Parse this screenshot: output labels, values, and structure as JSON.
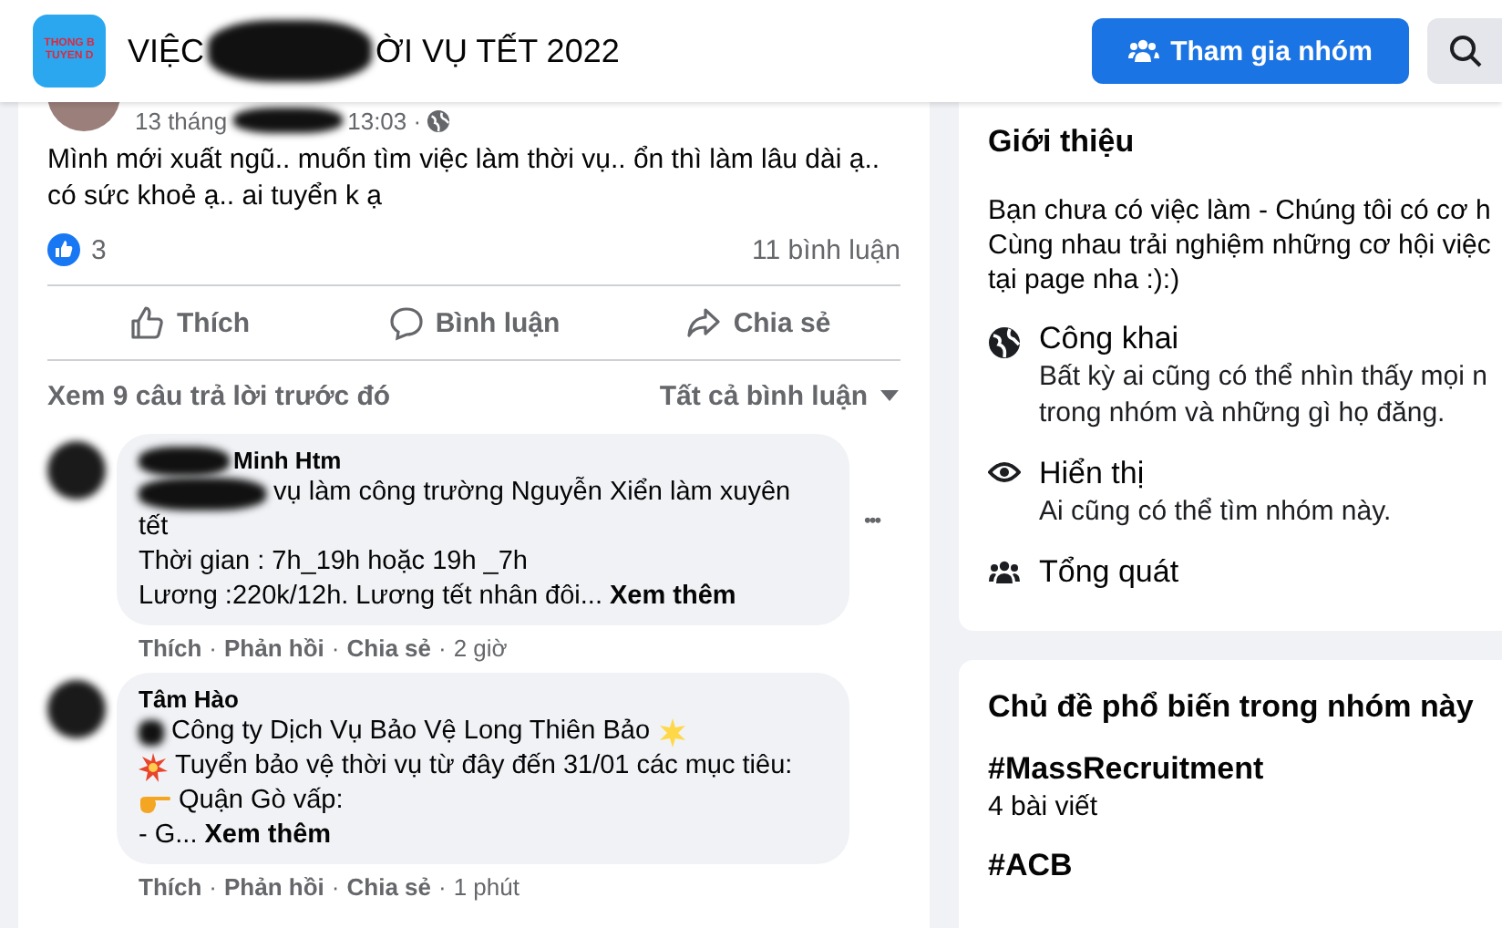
{
  "header": {
    "logo_lines": [
      "THONG B",
      "TUYEN D"
    ],
    "title_parts": [
      {
        "kind": "text",
        "text": "VIỆC"
      },
      {
        "kind": "redaction"
      },
      {
        "kind": "text",
        "text": "ỜI VỤ TẾT 2022"
      }
    ],
    "join_button": "Tham gia nhóm"
  },
  "post": {
    "time_parts": [
      {
        "kind": "text",
        "text": "13 tháng"
      },
      {
        "kind": "redaction"
      },
      {
        "kind": "text",
        "text": "13:03 ·"
      },
      {
        "kind": "globe"
      }
    ],
    "text_lines": [
      "Mình mới xuất ngũ.. muốn tìm việc làm thời vụ.. ổn thì làm lâu dài ạ..",
      "có sức khoẻ ạ.. ai tuyển k ạ"
    ],
    "like_count": "3",
    "comment_count": "11 bình luận",
    "actions": [
      {
        "kind": "like",
        "label": "Thích"
      },
      {
        "kind": "comment",
        "label": "Bình luận"
      },
      {
        "kind": "share",
        "label": "Chia sẻ"
      }
    ],
    "previous_replies": "Xem 9 câu trả lời trước đó",
    "filter": "Tất cả bình luận",
    "comments": [
      {
        "author_parts": [
          {
            "kind": "redaction"
          },
          {
            "kind": "text",
            "text": "Minh Htm"
          }
        ],
        "lines": [
          [
            {
              "kind": "redaction"
            },
            {
              "kind": "text",
              "text": "vụ làm công trường Nguyễn Xiển làm xuyên"
            }
          ],
          [
            {
              "kind": "text",
              "text": "tết"
            }
          ],
          [
            {
              "kind": "text",
              "text": "Thời gian : 7h_19h hoặc 19h _7h"
            }
          ],
          [
            {
              "kind": "text",
              "text": "Lương :220k/12h. Lương tết nhân đôi..."
            },
            {
              "kind": "more",
              "text": "Xem thêm"
            }
          ]
        ],
        "menu": "•••",
        "meta": [
          {
            "kind": "action",
            "text": "Thích"
          },
          {
            "kind": "separator",
            "text": "·"
          },
          {
            "kind": "action",
            "text": "Phản hồi"
          },
          {
            "kind": "separator",
            "text": "·"
          },
          {
            "kind": "action",
            "text": "Chia sẻ"
          },
          {
            "kind": "separator",
            "text": "·"
          },
          {
            "kind": "time",
            "text": "2 giờ"
          }
        ]
      },
      {
        "author_parts": [
          {
            "kind": "text",
            "text": "Tâm Hào"
          }
        ],
        "lines": [
          [
            {
              "kind": "redaction"
            },
            {
              "kind": "text",
              "text": "Công ty Dịch Vụ Bảo Vệ Long Thiên Bảo"
            },
            {
              "kind": "star"
            }
          ],
          [
            {
              "kind": "burst"
            },
            {
              "kind": "text",
              "text": "Tuyển bảo vệ thời vụ từ đây đến 31/01 các mục tiêu:"
            }
          ],
          [
            {
              "kind": "hand"
            },
            {
              "kind": "text",
              "text": "Quận Gò vấp:"
            }
          ],
          [
            {
              "kind": "text",
              "text": "- G..."
            },
            {
              "kind": "more",
              "text": "Xem thêm"
            }
          ]
        ],
        "meta": [
          {
            "kind": "action",
            "text": "Thích"
          },
          {
            "kind": "separator",
            "text": "·"
          },
          {
            "kind": "action",
            "text": "Phản hồi"
          },
          {
            "kind": "separator",
            "text": "·"
          },
          {
            "kind": "action",
            "text": "Chia sẻ"
          },
          {
            "kind": "separator",
            "text": "·"
          },
          {
            "kind": "time",
            "text": "1 phút"
          }
        ]
      }
    ]
  },
  "about": {
    "title": "Giới thiệu",
    "description_lines": [
      "Bạn chưa có việc làm - Chúng tôi có cơ h",
      "Cùng nhau trải nghiệm những cơ hội việc",
      "tại page nha :):)"
    ],
    "items": [
      {
        "kind": "globe",
        "title": "Công khai",
        "description_lines": [
          "Bất kỳ ai cũng có thể nhìn thấy mọi n",
          "trong nhóm và những gì họ đăng."
        ]
      },
      {
        "kind": "eye",
        "title": "Hiển thị",
        "description_lines": [
          "Ai cũng có thể tìm nhóm này."
        ]
      },
      {
        "kind": "people",
        "title": "Tổng quát"
      }
    ]
  },
  "topics": {
    "title": "Chủ đề phổ biến trong nhóm này",
    "items": [
      {
        "tag": "#MassRecruitment",
        "count": "4 bài viết"
      },
      {
        "tag": "#ACB"
      }
    ]
  }
}
